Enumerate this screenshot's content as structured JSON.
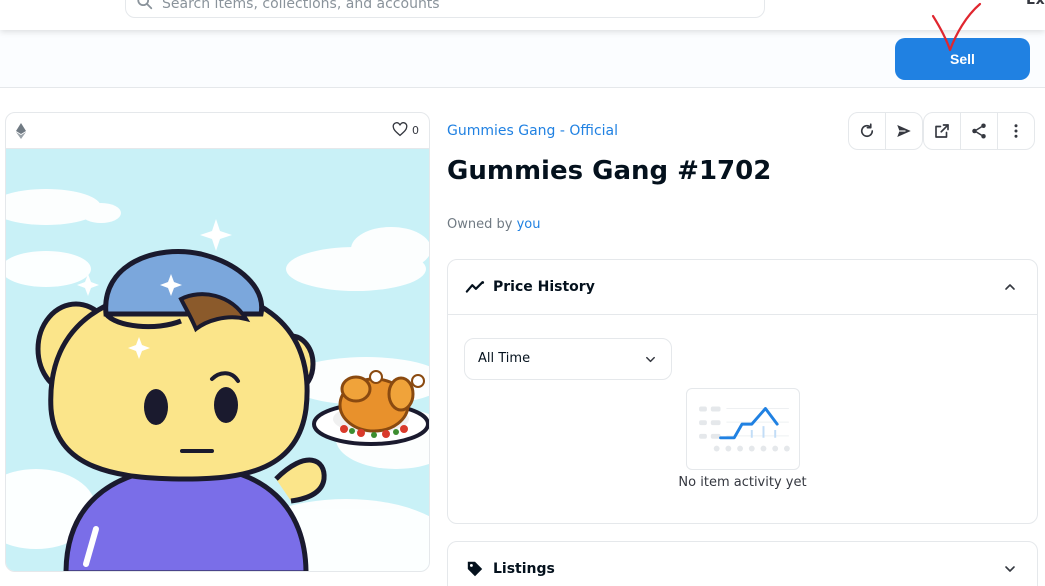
{
  "nav": {
    "search_placeholder": "Search items, collections, and accounts",
    "explore_label": "Explore"
  },
  "sellbar": {
    "sell_label": "Sell"
  },
  "item": {
    "favorites_count": "0",
    "collection_name": "Gummies Gang - Official",
    "title": "Gummies Gang #1702",
    "owned_prefix": "Owned by",
    "owner": "you"
  },
  "actions": [
    "refresh-icon",
    "transfer-icon",
    "open-external-icon",
    "share-icon",
    "more-icon"
  ],
  "price_history": {
    "label": "Price History",
    "filter_value": "All Time",
    "empty_text": "No item activity yet"
  },
  "listings": {
    "label": "Listings"
  },
  "colors": {
    "accent": "#2081e2",
    "border": "#e5e8eb",
    "annotation": "#e0262f"
  }
}
